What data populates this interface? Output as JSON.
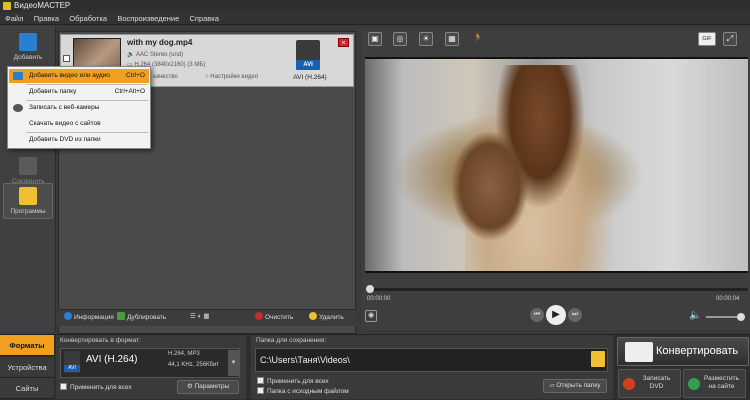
{
  "app": {
    "title": "ВидеоМАСТЕР"
  },
  "menu": [
    "Файл",
    "Правка",
    "Обработка",
    "Воспроизведение",
    "Справка"
  ],
  "left_sidebar": {
    "add_label": "Добавить",
    "join_label": "Соединить",
    "programs_label": "Программы"
  },
  "dropdown": [
    {
      "label": "Добавить видео или аудио",
      "shortcut": "Ctrl+O"
    },
    {
      "label": "Добавить папку",
      "shortcut": "Ctrl+Alt+O"
    },
    {
      "label": "Записать с веб-камеры",
      "shortcut": ""
    },
    {
      "label": "Скачать видео с сайтов",
      "shortcut": ""
    },
    {
      "label": "Добавить DVD из папки",
      "shortcut": ""
    }
  ],
  "file": {
    "name": "with my dog.mp4",
    "audio": "AAC Stereo (und)",
    "video": "H.264 (3840x2160) (3 МБ)",
    "quality": "щее качество",
    "settings": "Настройки видео",
    "format_label": "AVI (H.264)",
    "badge": "AVI"
  },
  "list_toolbar": {
    "info": "Информация",
    "duplicate": "Дублировать",
    "clear": "Очистить",
    "delete": "Удалить"
  },
  "player": {
    "tools": [
      "▣",
      "◎",
      "☀",
      "▦",
      "🏃"
    ],
    "gif": "GIF",
    "time_start": "00:00:00",
    "time_end": "00:00:04"
  },
  "bottom_tabs": [
    "Форматы",
    "Устройства",
    "Сайты"
  ],
  "format_panel": {
    "header": "Конвертировать в формат:",
    "format": "AVI (H.264)",
    "badge": "AVI",
    "specs1": "H.264, MP3",
    "specs2": "44,1 KHz, 256Кбит",
    "apply_all": "Применить для всех",
    "params": "Параметры"
  },
  "save_panel": {
    "header": "Папка для сохранения:",
    "path": "C:\\Users\\Таня\\Videos\\",
    "apply_all": "Применить для всех",
    "with_source": "Папка с исходным файлом",
    "open_folder": "Открыть папку"
  },
  "actions": {
    "convert": "Конвертировать",
    "dvd_line1": "Записать",
    "dvd_line2": "DVD",
    "site_line1": "Разместить",
    "site_line2": "на сайте"
  },
  "colors": {
    "accent": "#f0a020",
    "avi_blue": "#1b5fb0",
    "close_red": "#c03030"
  }
}
